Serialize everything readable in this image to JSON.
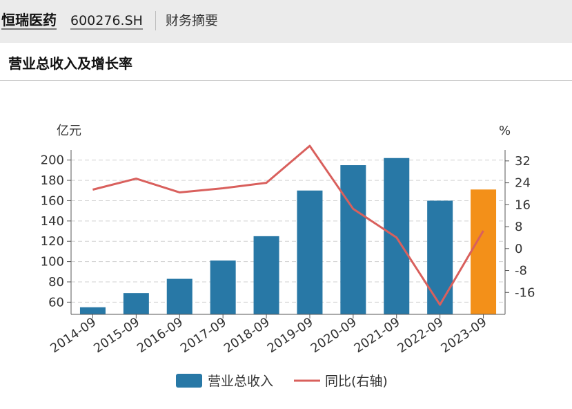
{
  "header": {
    "company_name": "恒瑞医药",
    "stock_code": "600276.SH",
    "section_label": "财务摘要"
  },
  "chart_title": "营业总收入及增长率",
  "colors": {
    "bar": "#2878a6",
    "bar_highlight": "#f39019",
    "line": "#d9605d",
    "grid": "#d0d0d0",
    "axis": "#555555"
  },
  "chart_data": {
    "type": "bar",
    "title": "营业总收入及增长率",
    "categories": [
      "2014-09",
      "2015-09",
      "2016-09",
      "2017-09",
      "2018-09",
      "2019-09",
      "2020-09",
      "2021-09",
      "2022-09",
      "2023-09"
    ],
    "y_left_unit": "亿元",
    "y_right_unit": "%",
    "y_left_ticks": [
      60,
      80,
      100,
      120,
      140,
      160,
      180,
      200
    ],
    "y_right_ticks": [
      32,
      24,
      16,
      8,
      0,
      -8,
      -16
    ],
    "y_left_range": [
      48,
      210
    ],
    "y_right_range": [
      -24,
      36
    ],
    "grid": true,
    "legend_position": "bottom-center",
    "highlight_index": 9,
    "series": [
      {
        "name": "营业总收入",
        "kind": "bar",
        "axis": "left",
        "values": [
          55,
          69,
          83,
          101,
          125,
          170,
          195,
          202,
          160,
          171
        ]
      },
      {
        "name": "同比(右轴)",
        "kind": "line",
        "axis": "right",
        "values": [
          21.5,
          25.5,
          20.5,
          22,
          24,
          37.5,
          14.5,
          4,
          -20.5,
          6.5
        ]
      }
    ]
  }
}
